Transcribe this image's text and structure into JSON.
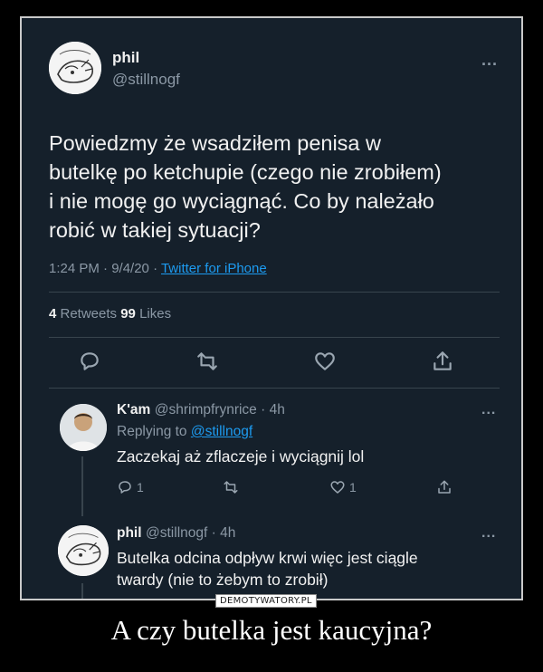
{
  "main_tweet": {
    "name": "phil",
    "handle": "@stillnogf",
    "more": "...",
    "text_lines": [
      "Powiedzmy że wsadziłem penisa w",
      "butelkę po ketchupie (czego nie zrobiłem)",
      "i nie mogę go wyciągnąć. Co by należało",
      "robić w takiej sytuacji?"
    ],
    "time": "1:24 PM · 9/4/20 · ",
    "source": "Twitter for iPhone",
    "retweets_count": "4",
    "retweets_label": " Retweets ",
    "likes_count": "99",
    "likes_label": " Likes",
    "actions": [
      "reply-icon",
      "retweet-icon",
      "like-icon",
      "share-icon"
    ]
  },
  "replies": [
    {
      "name": "K'am",
      "handle": "@shrimpfrynrice · 4h",
      "replying_prefix": "Replying to ",
      "replying_to": "@stillnogf",
      "text": "Zaczekaj aż zflaczeje i wyciągnij lol",
      "reply_count": "1",
      "like_count": "1",
      "more": "..."
    },
    {
      "name": "phil",
      "handle": "@stillnogf · 4h",
      "text_lines": [
        "Butelka odcina odpływ krwi więc jest ciągle",
        "twardy (nie to żebym to zrobił)"
      ],
      "more": "..."
    }
  ],
  "watermark": "DEMOTYWATORY.PL",
  "caption": "A czy butelka jest kaucyjna?",
  "colors": {
    "background": "#15202b",
    "link": "#1d9bf0",
    "muted": "#8b98a5",
    "text": "#e7e9ea"
  }
}
